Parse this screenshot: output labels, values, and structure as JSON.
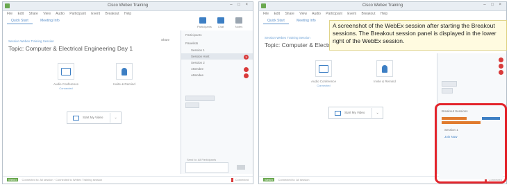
{
  "left": {
    "window_title": "Cisco Webex Training",
    "menu": [
      "File",
      "Edit",
      "Share",
      "View",
      "Audio",
      "Participant",
      "Event",
      "Breakout",
      "Help"
    ],
    "tabs": [
      "Quick Start",
      "Meeting Info"
    ],
    "toolbar": [
      "Participants",
      "Chat",
      "Notes"
    ],
    "meeting_link": "Session Webex Training Session",
    "topic": "Topic: Computer & Electrical Engineering Day 1",
    "share_label": "Share",
    "features": [
      {
        "label": "Audio Conference",
        "sub": "Connected"
      },
      {
        "label": "Invite & Remind"
      }
    ],
    "video_button": "Start My Video",
    "panel": {
      "header": "Participants",
      "panelists": "Panelists",
      "host_row": "Session Host",
      "groups": [
        "Session 1",
        "Session 2"
      ],
      "attendees": [
        "Attendee",
        "Attendee"
      ],
      "badge": "1"
    },
    "chat_to": "Send to: All Participants",
    "send": "Send",
    "status_tag": "Webex",
    "status_text": "Connected to: All session · Connected to Webex Training session",
    "status_right": "Connected"
  },
  "right": {
    "window_title": "Cisco Webex Training",
    "menu": [
      "File",
      "Edit",
      "Share",
      "View",
      "Audio",
      "Participant",
      "Event",
      "Breakout",
      "Help"
    ],
    "tabs": [
      "Quick Start",
      "Meeting Info"
    ],
    "meeting_link": "Session Webex Training Session",
    "topic": "Topic: Computer & Electrical Engineering Day 1",
    "features": [
      {
        "label": "Audio Conference",
        "sub": "Connected"
      },
      {
        "label": "Invite & Remind"
      }
    ],
    "video_button": "Start My Video",
    "breakout": {
      "header": "Breakout Sessions",
      "rows": [
        "Session 1",
        "Join Now"
      ]
    },
    "status_tag": "Webex",
    "status_text": "Connected to: All session",
    "status_right": "Connected"
  },
  "annotation": "A screenshot of the WebEx session after starting the Breakout sessions. The Breakout session panel is displayed in the lower right of the WebEx session.",
  "colors": {
    "accent": "#3d7fc4",
    "highlight": "#e3242b",
    "callout_bg": "#fffbe0",
    "badge": "#d93a3a"
  }
}
